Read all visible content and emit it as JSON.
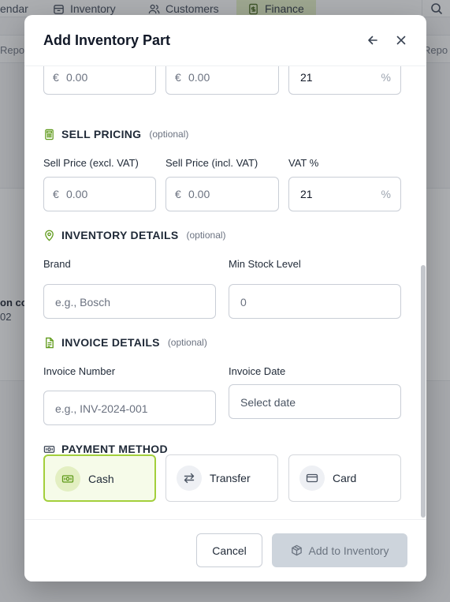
{
  "background": {
    "nav": {
      "calendar": "endar",
      "inventory": "Inventory",
      "customers": "Customers",
      "finance": "Finance"
    },
    "subnav_left": "Repo",
    "subnav_right": "Repo",
    "row_name": "on co",
    "row_sub": "02"
  },
  "modal": {
    "title": "Add Inventory Part",
    "back_icon": "arrow-left-icon",
    "close_icon": "close-icon",
    "purchase_pricing": {
      "excl": {
        "prefix": "€",
        "placeholder": "0.00"
      },
      "incl": {
        "prefix": "€",
        "placeholder": "0.00"
      },
      "vat": {
        "value": "21",
        "suffix": "%"
      }
    },
    "sell_pricing": {
      "title": "SELL PRICING",
      "optional": "(optional)",
      "icon": "calculator-icon",
      "excl_label": "Sell Price (excl. VAT)",
      "incl_label": "Sell Price (incl. VAT)",
      "vat_label": "VAT %",
      "excl": {
        "prefix": "€",
        "placeholder": "0.00"
      },
      "incl": {
        "prefix": "€",
        "placeholder": "0.00"
      },
      "vat": {
        "value": "21",
        "suffix": "%"
      }
    },
    "inventory_details": {
      "title": "INVENTORY DETAILS",
      "optional": "(optional)",
      "icon": "map-pin-icon",
      "brand_label": "Brand",
      "brand_placeholder": "e.g., Bosch",
      "min_stock_label": "Min Stock Level",
      "min_stock_placeholder": "0"
    },
    "invoice_details": {
      "title": "INVOICE DETAILS",
      "optional": "(optional)",
      "icon": "document-icon",
      "number_label": "Invoice Number",
      "number_placeholder": "e.g., INV-2024-001",
      "date_label": "Invoice Date",
      "date_placeholder": "Select date"
    },
    "payment_method": {
      "title": "PAYMENT METHOD",
      "icon": "banknote-icon",
      "selected": "Cash",
      "options": [
        {
          "label": "Cash",
          "icon": "banknote-icon"
        },
        {
          "label": "Transfer",
          "icon": "arrows-swap-icon"
        },
        {
          "label": "Card",
          "icon": "credit-card-icon"
        }
      ]
    },
    "footer": {
      "cancel": "Cancel",
      "submit": "Add to Inventory",
      "submit_icon": "package-icon"
    }
  },
  "colors": {
    "accent": "#a3cf3c",
    "accent_bg": "#f6fbe9",
    "icon_green": "#5f9a1a",
    "submit_disabled_bg": "#cdd4dc",
    "overlay": "rgba(60,64,72,0.42)"
  }
}
